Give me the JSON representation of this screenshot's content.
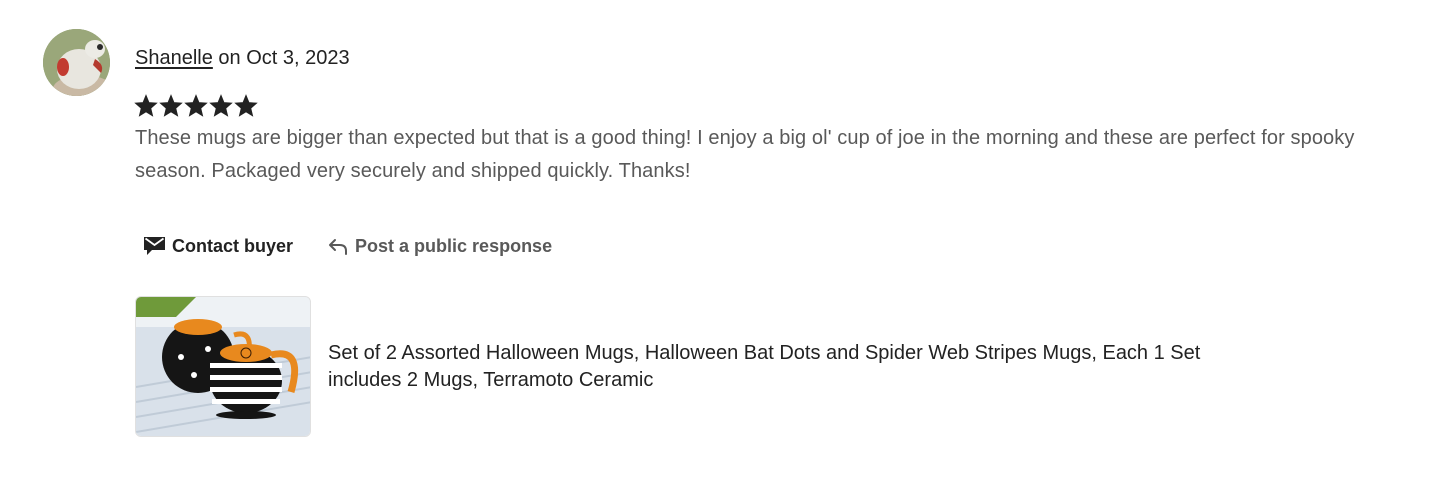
{
  "review": {
    "reviewer_name": "Shanelle",
    "date_text": "on Oct 3, 2023",
    "rating": 5,
    "rating_max": 5,
    "text": "These mugs are bigger than expected but that is a good thing! I enjoy a big ol' cup of joe in the morning and these are perfect for spooky season. Packaged very securely and shipped quickly. Thanks!"
  },
  "actions": {
    "contact_label": "Contact buyer",
    "contact_icon": "envelope-icon",
    "respond_label": "Post a public response",
    "respond_icon": "reply-arrow-icon"
  },
  "listing": {
    "title": "Set of 2 Assorted Halloween Mugs, Halloween Bat Dots and Spider Web Stripes Mugs, Each 1 Set includes 2 Mugs, Terramoto Ceramic"
  },
  "colors": {
    "text_primary": "#222222",
    "text_secondary": "#595959",
    "star": "#222222",
    "mug_orange": "#e8891e"
  }
}
